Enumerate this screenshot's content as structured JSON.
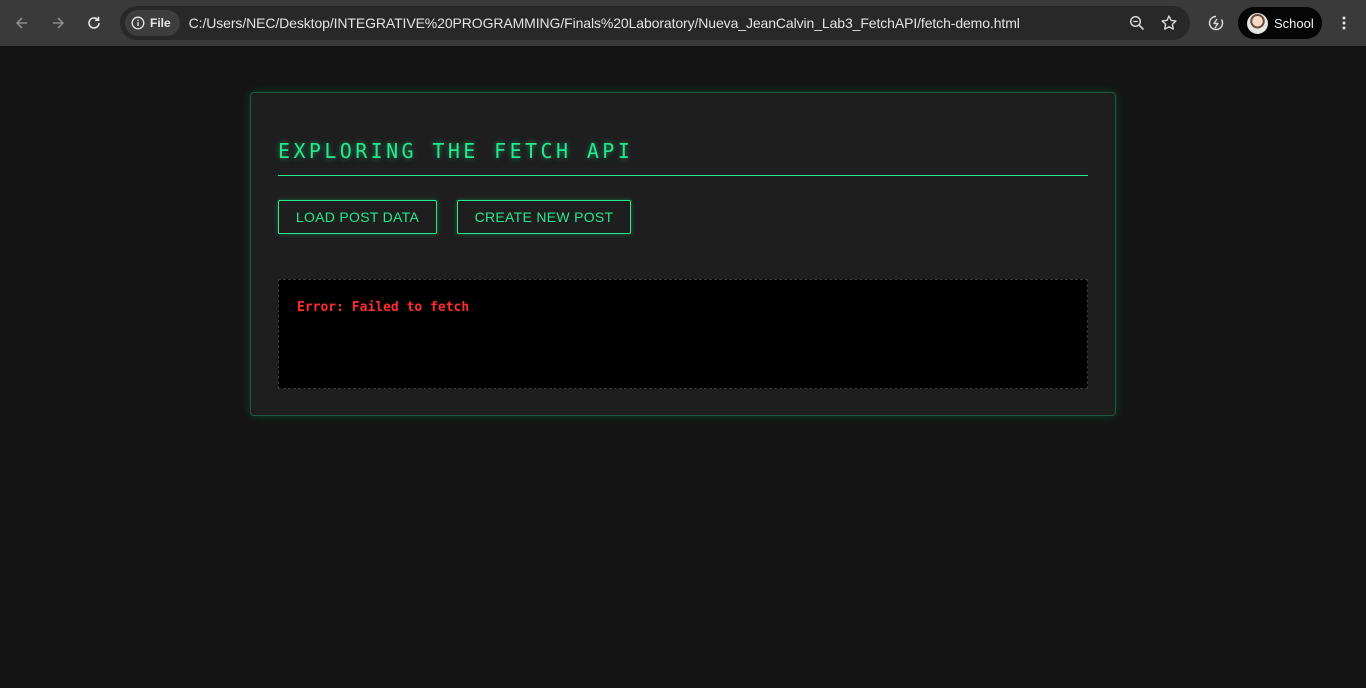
{
  "browser": {
    "address_bar": {
      "scheme_label": "File",
      "url": "C:/Users/NEC/Desktop/INTEGRATIVE%20PROGRAMMING/Finals%20Laboratory/Nueva_JeanCalvin_Lab3_FetchAPI/fetch-demo.html"
    },
    "profile": {
      "label": "School"
    },
    "icons": [
      "back-arrow-icon",
      "forward-arrow-icon",
      "reload-icon",
      "info-icon",
      "zoom-icon",
      "bookmark-star-icon",
      "performance-icon",
      "avatar",
      "more-menu-icon"
    ]
  },
  "page": {
    "title": "EXPLORING THE FETCH API",
    "buttons": {
      "load_label": "LOAD POST DATA",
      "create_label": "CREATE NEW POST"
    },
    "output": {
      "message": "Error: Failed to fetch"
    }
  },
  "colors": {
    "accent": "#26e890",
    "error": "#ff2d2d",
    "page_background": "#141414",
    "card_background": "#1e1e1e",
    "output_background": "#000000"
  }
}
